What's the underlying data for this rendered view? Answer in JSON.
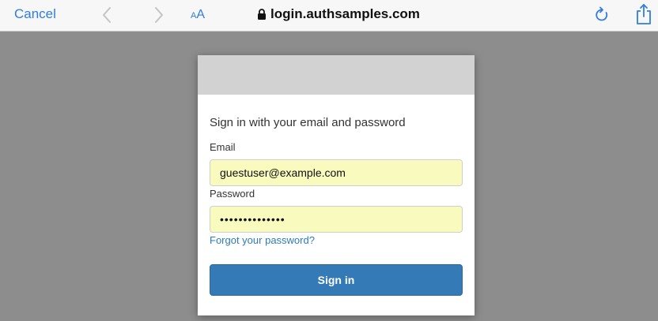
{
  "browser": {
    "cancel_label": "Cancel",
    "text_size_label_small": "A",
    "text_size_label_large": "A",
    "url": "login.authsamples.com",
    "icons": {
      "back": "chevron-left-icon",
      "forward": "chevron-right-icon",
      "lock": "lock-icon",
      "reload": "reload-icon",
      "share": "share-icon"
    },
    "accent_color": "#2f7de1"
  },
  "login": {
    "heading": "Sign in with your email and password",
    "email_label": "Email",
    "email_value": "guestuser@example.com",
    "password_label": "Password",
    "password_value": "••••••••••••••",
    "forgot_label": "Forgot your password?",
    "signin_label": "Sign in",
    "colors": {
      "button": "#337ab7",
      "link": "#2d7bbb",
      "autofill": "#f9fbbe",
      "backdrop": "#8d8d8d",
      "banner": "#d2d2d2"
    }
  }
}
